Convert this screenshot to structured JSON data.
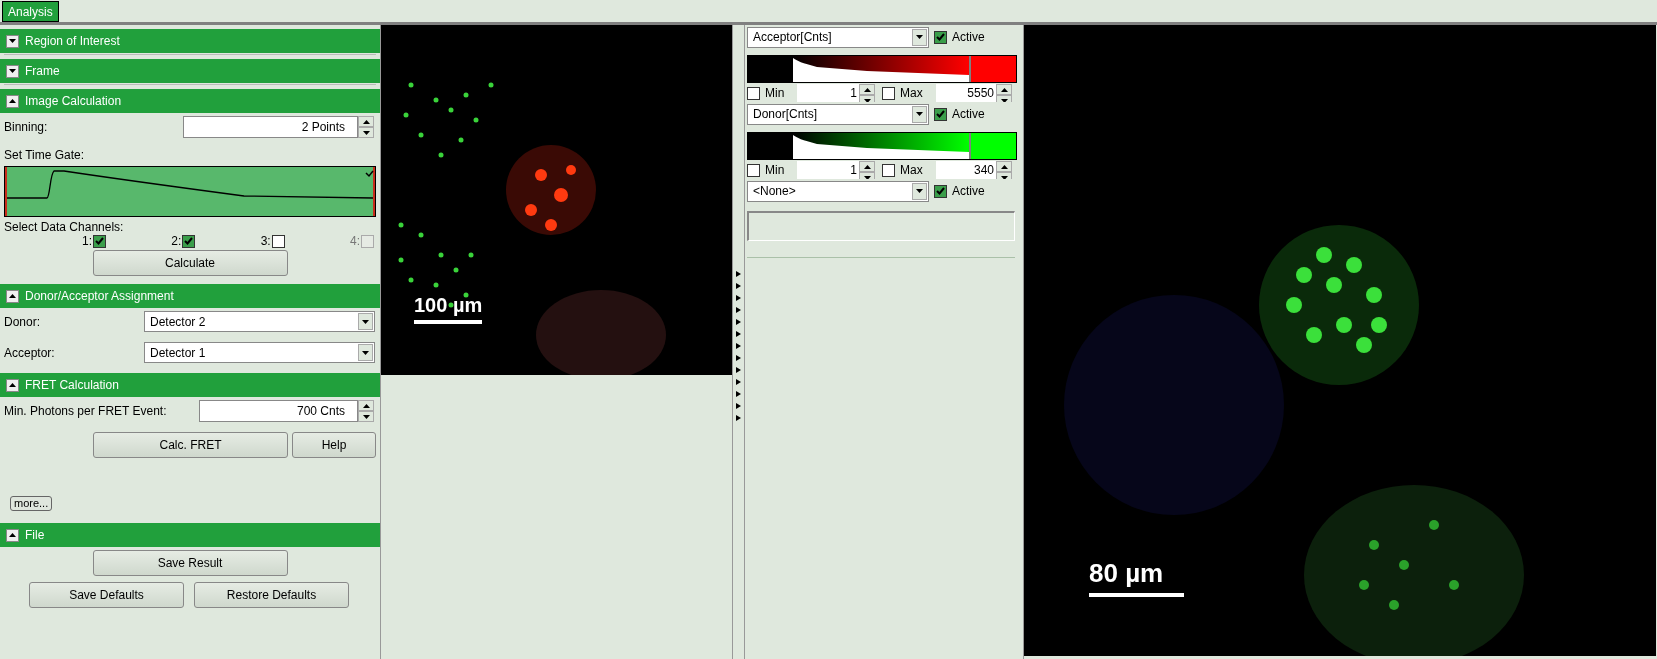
{
  "tabs": [
    {
      "label": "Analysis",
      "selected": true
    }
  ],
  "sections": [
    {
      "title": "Region of Interest",
      "expanded": false
    },
    {
      "title": "Frame",
      "expanded": false
    },
    {
      "kind": "image_calc",
      "title": "Image Calculation",
      "expanded": true,
      "binning": {
        "label": "Binning:",
        "value": "2 Points"
      },
      "time_gate_label": "Set Time Gate:",
      "channels_label": "Select Data Channels:",
      "channels": [
        {
          "label": "1:",
          "checked": true,
          "disabled": false
        },
        {
          "label": "2:",
          "checked": true,
          "disabled": false
        },
        {
          "label": "3:",
          "checked": false,
          "disabled": false
        },
        {
          "label": "4:",
          "checked": false,
          "disabled": true
        }
      ],
      "button": "Calculate"
    },
    {
      "kind": "assignment",
      "title": "Donor/Acceptor Assignment",
      "expanded": true,
      "fields": [
        {
          "label": "Donor:",
          "value": "Detector 2"
        },
        {
          "label": "Acceptor:",
          "value": "Detector 1"
        }
      ]
    },
    {
      "kind": "fret",
      "title": "FRET Calculation",
      "expanded": true,
      "min_photons": {
        "label": "Min. Photons per FRET Event:",
        "value": "700 Cnts"
      },
      "buttons": [
        "Calc. FRET",
        "Help"
      ],
      "more_button": "more..."
    },
    {
      "kind": "file",
      "title": "File",
      "expanded": true,
      "buttons": [
        "Save Result",
        "Save Defaults",
        "Restore Defaults"
      ]
    }
  ],
  "left_image": {
    "scale_label": "100 µm"
  },
  "color_channels": [
    {
      "kind": "histogram",
      "channel": "Acceptor[Cnts]",
      "active": true,
      "active_label": "Active",
      "color": "#ff0000",
      "min_label": "Min",
      "min_checked": false,
      "min_value": "1",
      "max_label": "Max",
      "max_checked": false,
      "max_value": "5550"
    },
    {
      "kind": "histogram",
      "channel": "Donor[Cnts]",
      "active": true,
      "active_label": "Active",
      "color": "#00ff00",
      "min_label": "Min",
      "min_checked": false,
      "min_value": "1",
      "max_label": "Max",
      "max_checked": false,
      "max_value": "340"
    },
    {
      "kind": "plain",
      "channel": "<None>",
      "active": true,
      "active_label": "Active"
    }
  ],
  "right_image": {
    "scale_label": "80 µm"
  }
}
